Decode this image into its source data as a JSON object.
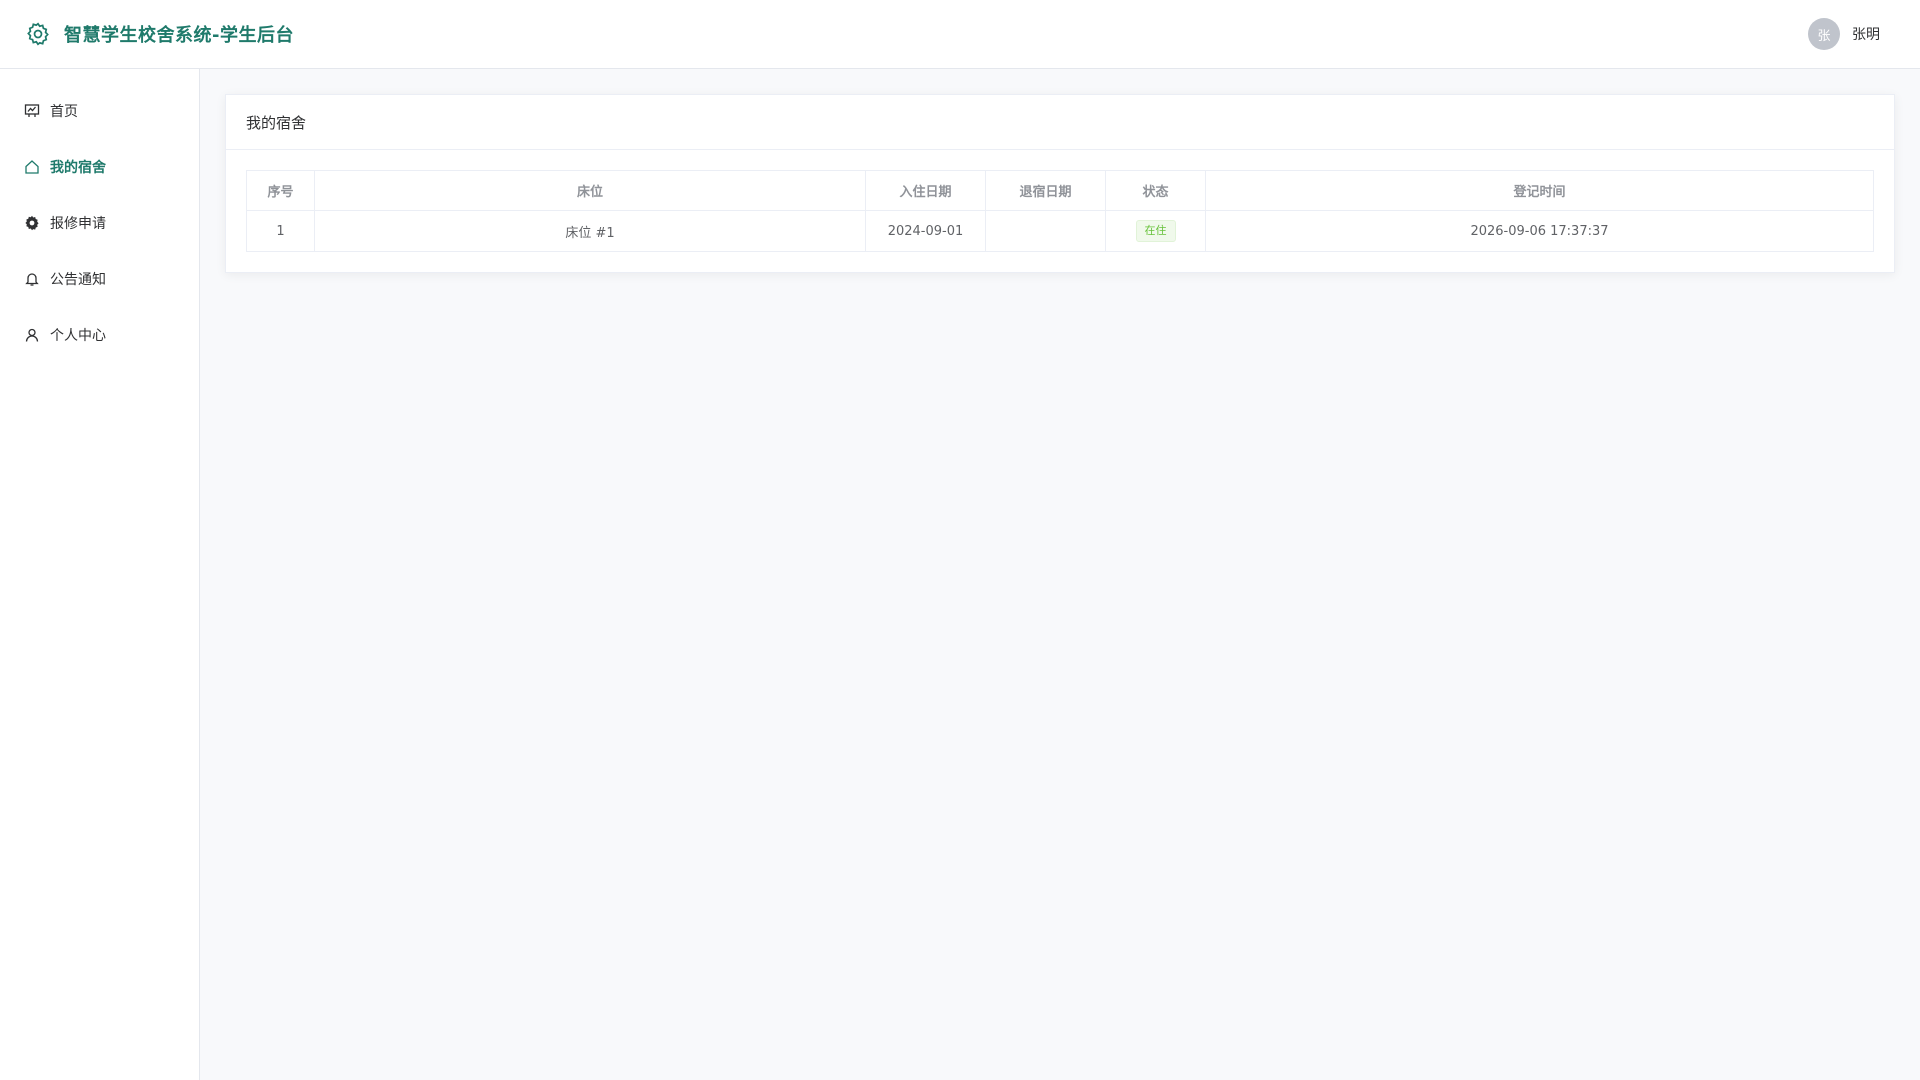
{
  "header": {
    "title": "智慧学生校舍系统-学生后台",
    "user_avatar": "张",
    "user_name": "张明"
  },
  "sidebar": {
    "items": [
      {
        "label": "首页",
        "icon": "dashboard-icon"
      },
      {
        "label": "我的宿舍",
        "icon": "home-icon",
        "active": true
      },
      {
        "label": "报修申请",
        "icon": "gear-icon"
      },
      {
        "label": "公告通知",
        "icon": "bell-icon"
      },
      {
        "label": "个人中心",
        "icon": "user-icon"
      }
    ]
  },
  "main": {
    "card_title": "我的宿舍",
    "table": {
      "columns": [
        "序号",
        "床位",
        "入住日期",
        "退宿日期",
        "状态",
        "登记时间"
      ],
      "rows": [
        {
          "index": "1",
          "bed": "床位 #1",
          "checkin": "2024-09-01",
          "checkout": "",
          "status": "在住",
          "registered": "2026-09-06 17:37:37"
        }
      ]
    }
  },
  "colors": {
    "brand": "#1f7a6b",
    "status_active": "#67c23a"
  }
}
